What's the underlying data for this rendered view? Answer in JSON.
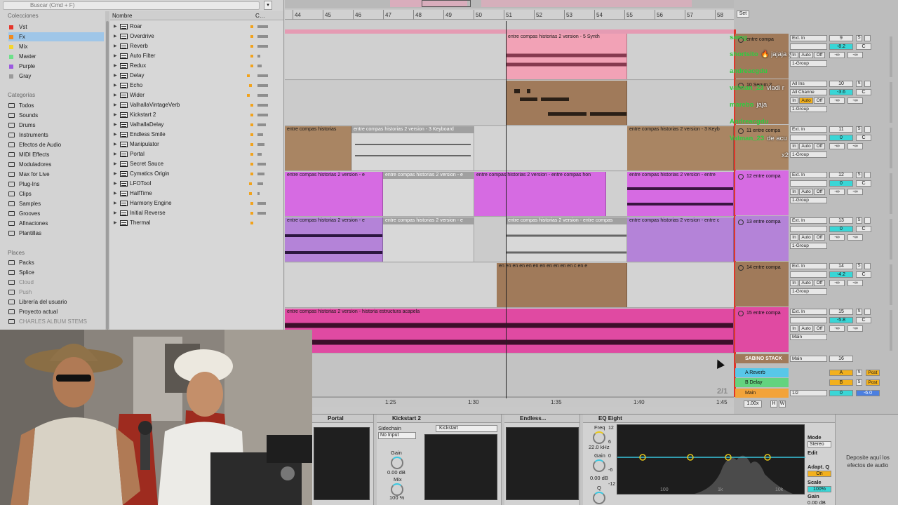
{
  "browser": {
    "search_placeholder": "Buscar (Cmd + F)",
    "colecciones_header": "Colecciones",
    "colecciones": [
      {
        "label": "Vst",
        "color": "#e5352a"
      },
      {
        "label": "Fx",
        "color": "#ef8a21",
        "selected": true
      },
      {
        "label": "Mix",
        "color": "#f4d52f"
      },
      {
        "label": "Master",
        "color": "#6ee08a"
      },
      {
        "label": "Purple",
        "color": "#9b59e0"
      },
      {
        "label": "Gray",
        "color": "#9a9a9a"
      }
    ],
    "categorias_header": "Categorías",
    "categorias": [
      "Todos",
      "Sounds",
      "Drums",
      "Instruments",
      "Efectos de Audio",
      "MIDI Effects",
      "Moduladores",
      "Max for Live",
      "Plug-Ins",
      "Clips",
      "Samples",
      "Grooves",
      "Afinaciones",
      "Plantillas"
    ],
    "places_header": "Places",
    "places": [
      "Packs",
      "Splice",
      "Cloud",
      "Push",
      "Librería del usuario",
      "Proyecto actual",
      "CHARLES ALBUM STEMS"
    ],
    "list_header_name": "Nombre",
    "list_header_c": "C…",
    "devices": [
      "Roar",
      "Overdrive",
      "Reverb",
      "Auto Filter",
      "Redux",
      "Delay",
      "Echo",
      "Wider",
      "ValhallaVintageVerb",
      "Kickstart 2",
      "ValhallaDelay",
      "Endless Smile",
      "Manipulator",
      "Portal",
      "Secret Sauce",
      "Cymatics Origin",
      "LFOTool",
      "HalfTime",
      "Harmony Engine",
      "Initial Reverse",
      "Thermal"
    ]
  },
  "arrangement": {
    "bars": [
      "44",
      "45",
      "46",
      "47",
      "48",
      "49",
      "50",
      "51",
      "52",
      "53",
      "54",
      "55",
      "56",
      "57",
      "58"
    ],
    "time_labels": [
      "1:25",
      "1:30",
      "1:35",
      "1:40",
      "1:45"
    ],
    "page_fraction": "2/1",
    "set_label": "Set",
    "clips": {
      "synth": "entre compas historias 2 version - 5 Synth",
      "keyboard_a": "entre compas historias",
      "keyboard_b": "entre compas historias 2 version - 3 Keyboard",
      "keyboard_c": "entre compas historias 2 version - 3 Keyb",
      "purple12_a": "entre compas historias 2 version - e",
      "purple12_b": "entre compas historias 2 version - e",
      "purple12_c": "entre compas historias 2 version - entre compas hon",
      "purple12_d": "entre compas historias 2 version - entre",
      "lilac13_a": "entre compas historias 2 version - e",
      "lilac13_b": "entre compas historias 2 version - e",
      "lilac13_c": "entre compas historias 2 version - entre compas",
      "lilac13_d": "entre compas historias 2 version - entre c",
      "brown14": "en en en en en en en en en en en c en e",
      "acapela": "entre compas historias 2 version - historia estructura acapela"
    }
  },
  "mixer": {
    "tracks": [
      {
        "name": "entre compa",
        "input": "Ext. In",
        "route": "1-Group",
        "num": "9",
        "vol": "-8.2",
        "pan": "C"
      },
      {
        "name": "10 Serum 2",
        "input": "All Ins",
        "channel": "All Channe",
        "route": "1-Group",
        "num": "10",
        "vol": "-3.6",
        "pan": "C"
      },
      {
        "name": "11 entre compa",
        "input": "Ext. In",
        "route": "1-Group",
        "num": "11",
        "vol": "0",
        "pan": "C"
      },
      {
        "name": "12 entre compa",
        "input": "Ext. In",
        "route": "1-Group",
        "num": "12",
        "vol": "0",
        "pan": "C"
      },
      {
        "name": "13 entre compa",
        "input": "Ext. In",
        "route": "1-Group",
        "num": "13",
        "vol": "0",
        "pan": "C"
      },
      {
        "name": "14 entre compa",
        "input": "Ext. In",
        "route": "1-Group",
        "num": "14",
        "vol": "-4.2",
        "pan": "C"
      },
      {
        "name": "15 entre compa",
        "input": "Ext. In",
        "route": "Main",
        "num": "15",
        "vol": "-5.8",
        "pan": "C"
      }
    ],
    "sabino": {
      "name": "SABINO STACK",
      "route": "Main",
      "num": "16"
    },
    "returns": [
      {
        "name": "A Reverb",
        "letter": "A",
        "color": "#58c7e8"
      },
      {
        "name": "B Delay",
        "letter": "B",
        "color": "#63d37f"
      }
    ],
    "main": {
      "name": "Main",
      "route": "1/2",
      "vol": "0",
      "vol2": "-6.0"
    },
    "labels": {
      "in": "In",
      "auto": "Auto",
      "off": "Off",
      "s": "S",
      "c": "C",
      "post": "Post",
      "inf": "-∞"
    },
    "zoom": "1.00x",
    "h": "H",
    "w": "W"
  },
  "chat": [
    {
      "name": "samg",
      "msg": ""
    },
    {
      "name": "shortsito",
      "msg": "🔥 jajaja y"
    },
    {
      "name": "andreacgdu",
      "msg": ""
    },
    {
      "name": "valman_23",
      "msg": "vladi r"
    },
    {
      "name": "marebo",
      "msg": "jaja"
    },
    {
      "name": "Andreacgdu",
      "msg": ""
    },
    {
      "name": "Valman_23",
      "msg": "de acu"
    },
    {
      "name": "",
      "msg": "x2"
    }
  ],
  "device_chain": {
    "portal": {
      "title": "Portal"
    },
    "kickstart": {
      "title": "Kickstart 2",
      "sidechain": "Sidechain",
      "input": "No Input",
      "preset": "Kickstart",
      "gain_label": "Gain",
      "gain_value": "0.00 dB",
      "mix_label": "Mix",
      "mix_value": "100 %"
    },
    "endless": {
      "title": "Endless..."
    },
    "eq": {
      "title": "EQ Eight",
      "freq_label": "Freq",
      "freq_value": "22.0 kHz",
      "gain_label": "Gain",
      "gain_value": "0.00 dB",
      "q_label": "Q",
      "db_labels": [
        "12",
        "6",
        "0",
        "-6",
        "-12"
      ],
      "hz_labels": [
        "100",
        "1k",
        "10k"
      ],
      "mode_label": "Mode",
      "mode_value": "Stereo",
      "edit_label": "Edit",
      "adapt_label": "Adapt. Q",
      "adapt_value": "On",
      "scale_label": "Scale",
      "scale_value": "100%",
      "gain2_label": "Gain",
      "gain2_value": "0.00 dB"
    },
    "drop_hint": "Deposite aquí los efectos de audio"
  }
}
